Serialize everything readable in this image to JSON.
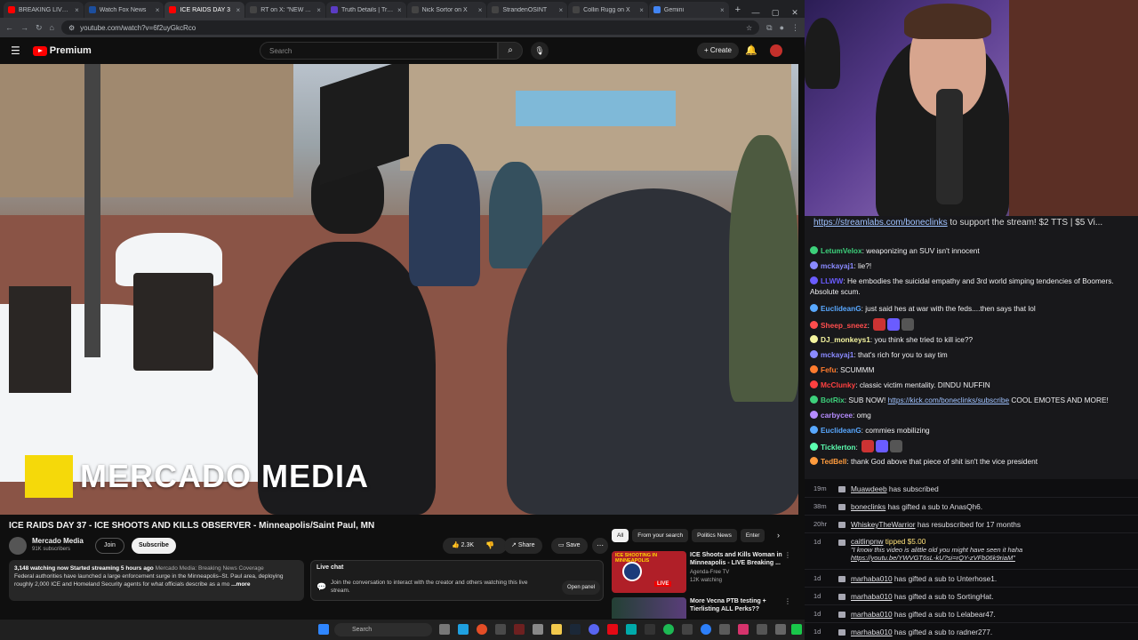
{
  "browser": {
    "tabs": [
      {
        "label": "BREAKING LIVE: ICE",
        "color": "#ff0000"
      },
      {
        "label": "Watch Fox News",
        "color": "#1c4e9d"
      },
      {
        "label": "ICE RAIDS DAY 3",
        "color": "#ff0000",
        "active": true
      },
      {
        "label": "RT on X: \"NEW AND",
        "color": "#444"
      },
      {
        "label": "Truth Details | Truth",
        "color": "#5b3cc4"
      },
      {
        "label": "Nick Sortor on X",
        "color": "#444"
      },
      {
        "label": "StrandenOSINT",
        "color": "#444"
      },
      {
        "label": "Collin Rugg on X",
        "color": "#444"
      },
      {
        "label": "Gemini",
        "color": "#4285f4"
      }
    ],
    "new_tab": "+",
    "url": "youtube.com/watch?v=6f2uyGkcRco"
  },
  "youtube": {
    "logo_text": "Premium",
    "search_placeholder": "Search",
    "create_label": "Create",
    "video_overlay_text": "MERCADO MEDIA",
    "video_title": "ICE RAIDS DAY 37 - ICE SHOOTS AND KILLS OBSERVER - Minneapolis/Saint Paul, MN",
    "channel_name": "Mercado Media",
    "subscribers": "91K subscribers",
    "join_label": "Join",
    "subscribe_label": "Subscribe",
    "likes": "2.3K",
    "share_label": "Share",
    "save_label": "Save",
    "description": {
      "stats": "3,148 watching now  Started streaming 5 hours ago",
      "source": "Mercado Media: Breaking News Coverage",
      "text": "Federal authorities have launched a large enforcement surge in the Minneapolis–St. Paul area, deploying roughly 2,000 ICE and Homeland Security agents for what officials describe as a mo",
      "more": "...more"
    },
    "live_chat": {
      "title": "Live chat",
      "text": "Join the conversation to interact with the creator and others watching this live stream.",
      "open_panel": "Open panel"
    },
    "chips": [
      "All",
      "From your search",
      "Politics News",
      "Enter"
    ],
    "related": [
      {
        "title": "ICE Shoots and Kills Woman in Minneapolis - LIVE Breaking ...",
        "channel": "Agenda-Free TV",
        "views": "12K watching",
        "thumb_text": "ICE SHOOTING IN MINNEAPOLIS",
        "badge": "LIVE"
      },
      {
        "title": "More Vecna PTB testing + Tierlisting ALL Perks??",
        "channel": "",
        "views": "",
        "thumb_text": "",
        "badge": ""
      }
    ]
  },
  "taskbar": {
    "search_label": "Search"
  },
  "stream_chat": {
    "banner_link": "https://streamlabs.com/boneclinks",
    "banner_text": " to support the stream! $2 TTS | $5 Vi...",
    "messages": [
      {
        "user": "LetumVelox",
        "color": "#3dd07b",
        "text": "weaponizing an SUV isn't innocent"
      },
      {
        "user": "mckayaj1",
        "color": "#8a8aff",
        "text": "lie?!"
      },
      {
        "user": "LLWW",
        "color": "#6a5cff",
        "text": "He embodies the suicidal empathy and 3rd world simping tendencies of Boomers. Absolute scum."
      },
      {
        "user": "EuclideanG",
        "color": "#59a8ff",
        "text": "just said hes at war with the feds....then says that lol"
      },
      {
        "user": "Sheep_sneez",
        "color": "#ff4d4d",
        "text": ""
      },
      {
        "user": "DJ_monkeys1",
        "color": "#f5f5a0",
        "text": "you think she tried to kill ice??"
      },
      {
        "user": "mckayaj1",
        "color": "#8a8aff",
        "text": "that's rich for you to say tim"
      },
      {
        "user": "Fefu",
        "color": "#ff7b2e",
        "text": "SCUMMM"
      },
      {
        "user": "McClunky",
        "color": "#ff4040",
        "text": "classic victim mentality. DINDU NUFFIN"
      },
      {
        "user": "BotRix",
        "color": "#3dd07b",
        "text": "SUB NOW! ",
        "link": "https://kick.com/boneclinks/subscribe",
        "after": " COOL EMOTES AND MORE!"
      },
      {
        "user": "carbycee",
        "color": "#b68cff",
        "text": "omg"
      },
      {
        "user": "EuclideanG",
        "color": "#59a8ff",
        "text": "commies mobilizing"
      },
      {
        "user": "Ticklerton",
        "color": "#5cffb0",
        "text": ""
      },
      {
        "user": "TedBell",
        "color": "#ff9b3d",
        "text": "thank God above that piece of shit isn't the vice president"
      }
    ]
  },
  "activity": [
    {
      "time": "19m",
      "user": "Muawdeeb",
      "text": " has subscribed"
    },
    {
      "time": "38m",
      "user": "boneclinks",
      "text": " has gifted a sub to AnasQh6."
    },
    {
      "time": "20hr",
      "user": "WhiskeyTheWarrior",
      "text": " has resubscribed for 17 months"
    },
    {
      "time": "1d",
      "user": "caitlinpnw",
      "text": " tipped $5.00",
      "quote": "\"I know this video is alittle old you might have seen it haha",
      "quote_link": "https://youtu.be/YWVGT6sL-kU?si=rQY-zVFb06k9riaM\""
    },
    {
      "time": "1d",
      "user": "marhaba010",
      "text": " has gifted a sub to Unterhose1."
    },
    {
      "time": "1d",
      "user": "marhaba010",
      "text": " has gifted a sub to SortingHat."
    },
    {
      "time": "1d",
      "user": "marhaba010",
      "text": " has gifted a sub to Lelabear47."
    },
    {
      "time": "1d",
      "user": "marhaba010",
      "text": " has gifted a sub to radner277."
    }
  ]
}
